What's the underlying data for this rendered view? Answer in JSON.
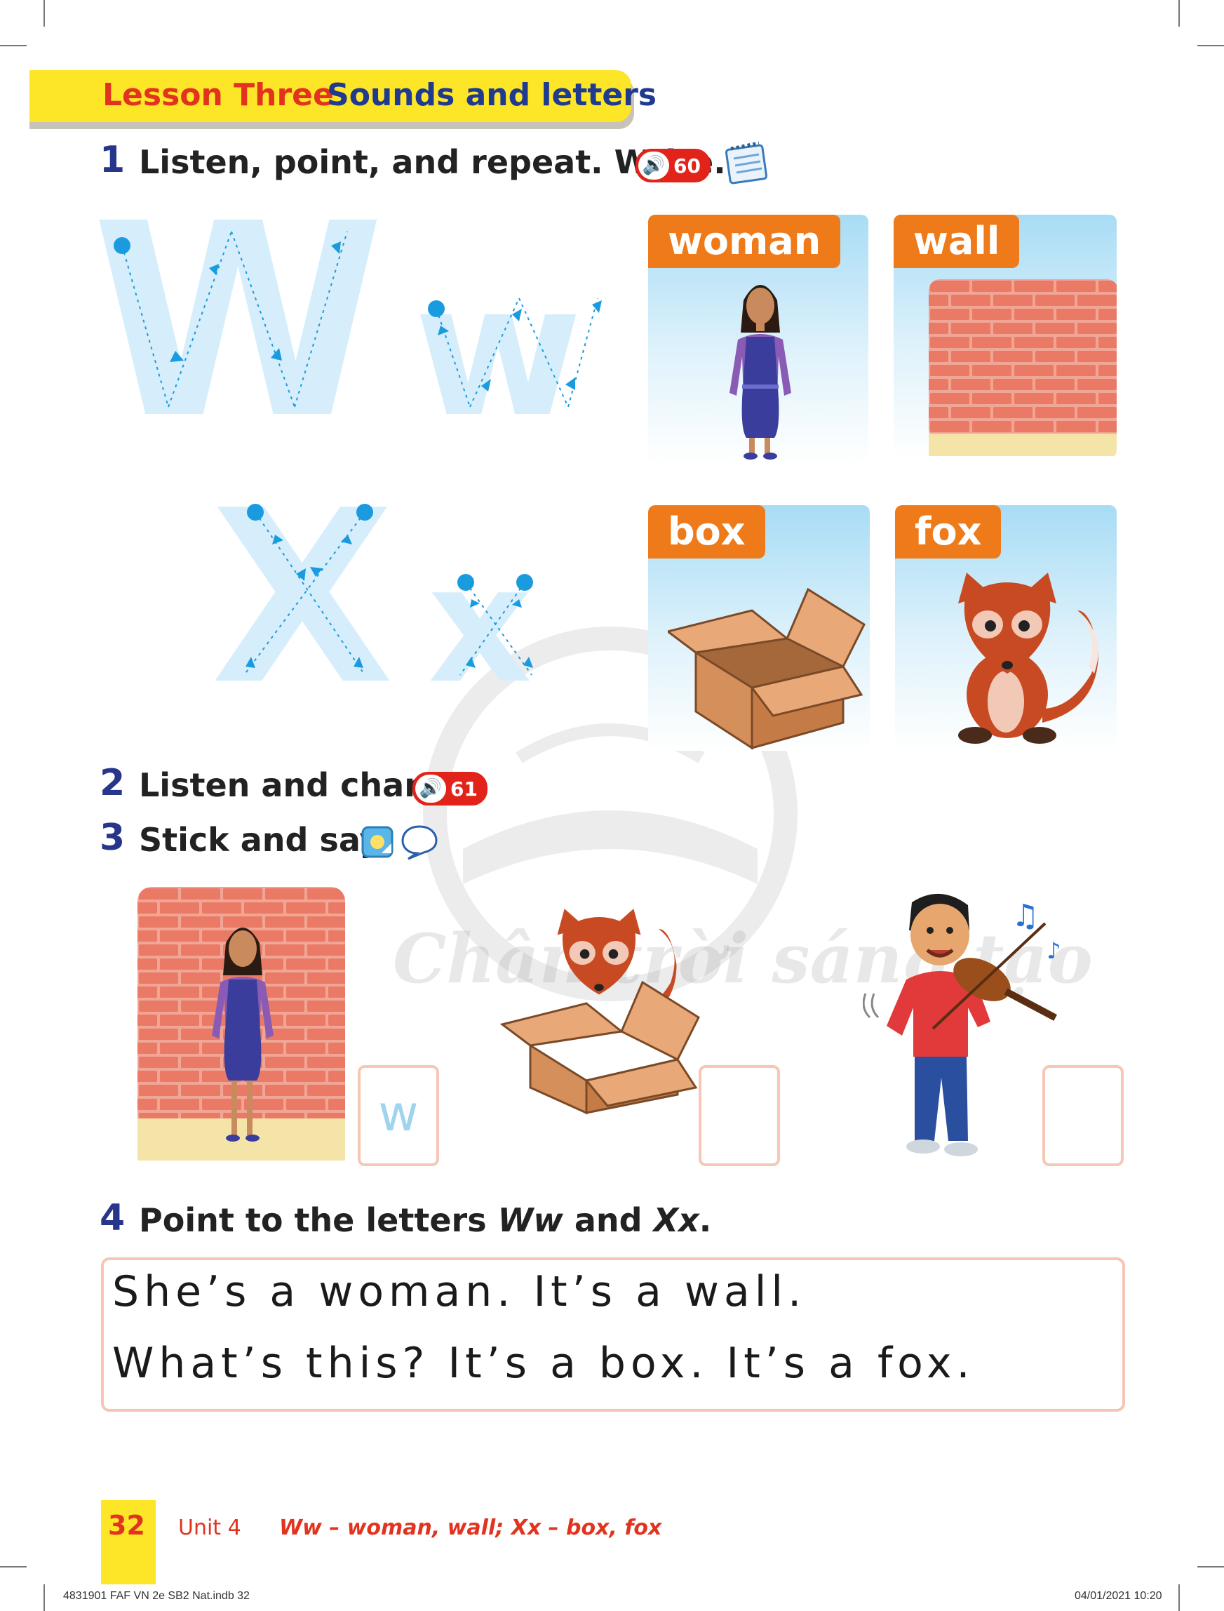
{
  "header": {
    "lesson_label": "Lesson Three",
    "lesson_title": "Sounds and letters"
  },
  "activity1": {
    "number": "1",
    "instruction": "Listen, point, and repeat. Write.",
    "audio_track": "60",
    "letters_w": [
      "W",
      "w"
    ],
    "letters_x": [
      "X",
      "x"
    ],
    "cards": [
      {
        "label": "woman",
        "letter_color": "#ffffff"
      },
      {
        "label": "wall",
        "letter_color": "#ffffff"
      },
      {
        "label": "box",
        "letter_color": "#ffffff"
      },
      {
        "label": "fox",
        "letter_color": "#ffffff"
      }
    ]
  },
  "activity2": {
    "number": "2",
    "instruction": "Listen and chant.",
    "audio_track": "61"
  },
  "activity3": {
    "number": "3",
    "instruction": "Stick and say.",
    "answer_boxes": [
      "w",
      "",
      ""
    ]
  },
  "activity4": {
    "number": "4",
    "instruction_prefix": "Point to the letters ",
    "instruction_ww": "Ww",
    "instruction_and": " and ",
    "instruction_xx": "Xx",
    "instruction_suffix": ".",
    "sentences": [
      "She’s a woman. It’s a wall.",
      "What’s this? It’s a box. It’s a fox."
    ]
  },
  "footer": {
    "page_number": "32",
    "unit": "Unit 4",
    "topic": "Ww – woman, wall; Xx – box, fox",
    "slug_left": "4831901 FAF VN 2e SB2 Nat.indb   32",
    "slug_right": "04/01/2021   10:20"
  },
  "watermark": "Chân trời sáng tạo",
  "colors": {
    "banner": "#fde528",
    "lesson_red": "#e2331f",
    "lesson_blue": "#1f3a8f",
    "card_label": "#ef7a1a",
    "tracing": "#d6eefb",
    "tracing_arrow": "#1a9be0"
  }
}
